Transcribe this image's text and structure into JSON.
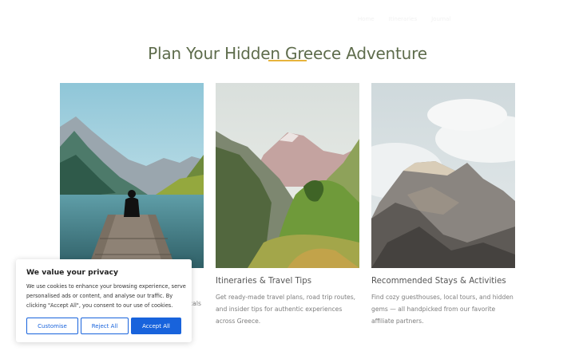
{
  "nav": {
    "items": [
      "Home",
      "Itineraries",
      "Journal"
    ]
  },
  "section": {
    "title": "Plan Your Hidden Greece Adventure",
    "accent_color": "#e7b43c",
    "title_color": "#5e6c4c"
  },
  "cards": [
    {
      "title": "",
      "text": "",
      "text_visible_fragment": "cals",
      "image": "person-on-dock-fjord-photo"
    },
    {
      "title": "Itineraries & Travel Tips",
      "text": "Get ready-made travel plans, road trip routes, and insider tips for authentic experiences across Greece.",
      "image": "green-mountain-valley-photo"
    },
    {
      "title": "Recommended Stays & Activities",
      "text": "Find cozy guesthouses, local tours, and hidden gems — all handpicked from our favorite affiliate partners.",
      "image": "misty-rocky-peak-photo"
    }
  ],
  "cookie_banner": {
    "title": "We value your privacy",
    "text": "We use cookies to enhance your browsing experience, serve personalised ads or content, and analyse our traffic. By clicking \"Accept All\", you consent to our use of cookies.",
    "customise_label": "Customise",
    "reject_label": "Reject All",
    "accept_label": "Accept All",
    "accent_color": "#1863dc"
  }
}
